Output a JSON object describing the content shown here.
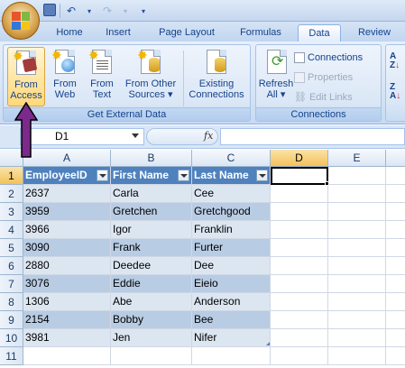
{
  "ribbon": {
    "tabs": [
      {
        "label": "Home"
      },
      {
        "label": "Insert"
      },
      {
        "label": "Page Layout"
      },
      {
        "label": "Formulas"
      },
      {
        "label": "Data"
      },
      {
        "label": "Review"
      }
    ],
    "active_tab": "Data",
    "get_external_data": {
      "group_label": "Get External Data",
      "from_access": "From\nAccess",
      "from_web": "From\nWeb",
      "from_text": "From\nText",
      "from_other_sources": "From Other\nSources ▾"
    },
    "existing_connections": "Existing\nConnections",
    "connections_group": {
      "group_label": "Connections",
      "refresh_all": "Refresh\nAll ▾",
      "connections": "Connections",
      "properties": "Properties",
      "edit_links": "Edit Links"
    }
  },
  "formula_bar": {
    "name_box": "D1",
    "fx": "fx",
    "formula": ""
  },
  "grid": {
    "columns": [
      "A",
      "B",
      "C",
      "D",
      "E"
    ],
    "rows": [
      "1",
      "2",
      "3",
      "4",
      "5",
      "6",
      "7",
      "8",
      "9",
      "10",
      "11"
    ],
    "selected_column": "D",
    "selected_row": "1",
    "table_headers": [
      "EmployeeID",
      "First Name",
      "Last Name"
    ],
    "table_rows": [
      [
        "2637",
        "Carla",
        "Cee"
      ],
      [
        "3959",
        "Gretchen",
        "Gretchgood"
      ],
      [
        "3966",
        "Igor",
        "Franklin"
      ],
      [
        "3090",
        "Frank",
        "Furter"
      ],
      [
        "2880",
        "Deedee",
        "Dee"
      ],
      [
        "3076",
        "Eddie",
        "Eieio"
      ],
      [
        "1306",
        "Abe",
        "Anderson"
      ],
      [
        "2154",
        "Bobby",
        "Bee"
      ],
      [
        "3981",
        "Jen",
        "Nifer"
      ]
    ]
  },
  "colors": {
    "table_header": "#4f81bd",
    "band_dark": "#b8cce4",
    "band_light": "#dce6f1",
    "annotation_arrow": "#7b2a8c"
  }
}
